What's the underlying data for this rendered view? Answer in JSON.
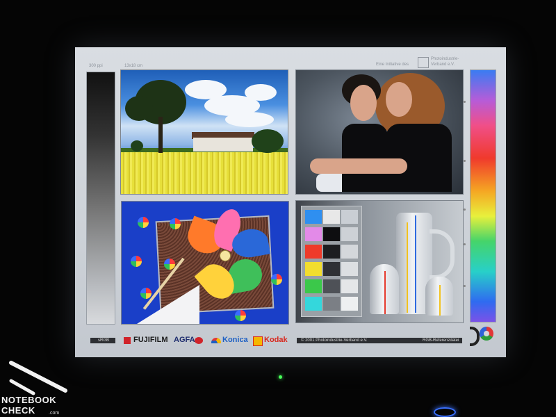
{
  "monitor_test_chart": {
    "top_labels": {
      "resolution": "300 ppi",
      "format": "13x18 cm",
      "initiative": "Eine Initiative des",
      "association_line1": "Photoindustrie-",
      "association_line2": "Verband e.V."
    },
    "photos": [
      {
        "id": "landscape",
        "label": "landscape-photo"
      },
      {
        "id": "portrait",
        "label": "portrait-photo"
      },
      {
        "id": "pinwheel",
        "label": "pinwheel-photo"
      },
      {
        "id": "still_life",
        "label": "color-checker-and-vases-photo"
      }
    ],
    "footer": {
      "srgb": "sRGB",
      "brands": [
        "FUJIFILM",
        "AGFA",
        "Konica",
        "Kodak"
      ],
      "copyright": "© 2001 Photoindustrie-Verband e.V.",
      "reference": "RGB-Referenzdatei"
    },
    "colors": {
      "agfa": "#1c2b6d",
      "fujifilm_red": "#d0232a",
      "konica_blue": "#1c5fc4",
      "kodak_red": "#d8261c",
      "kodak_yellow": "#f5b700"
    }
  },
  "watermark": {
    "line1": "NOTEBOOK",
    "line2": "CHECK",
    "suffix": ".com"
  }
}
